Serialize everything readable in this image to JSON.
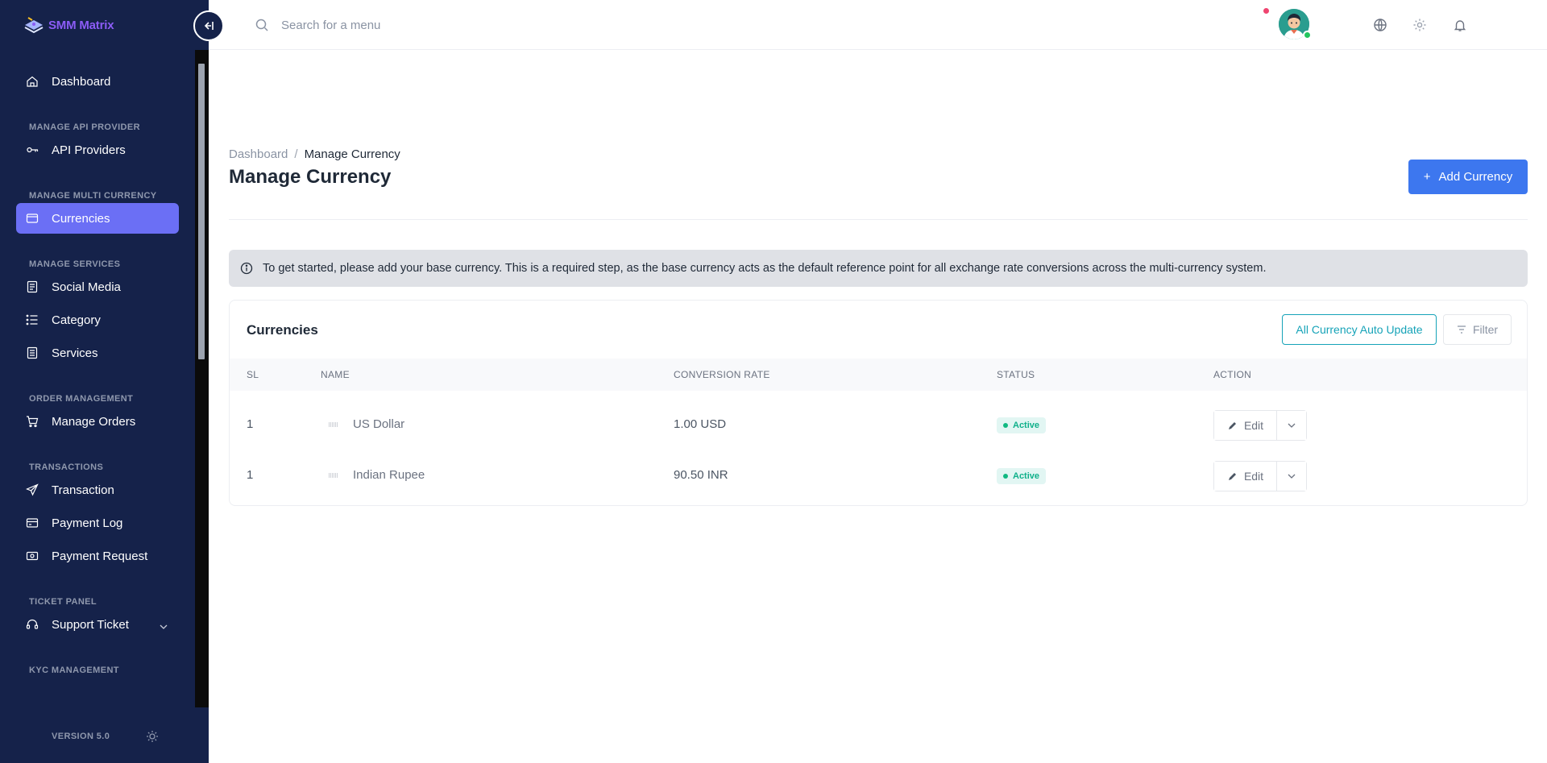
{
  "app": {
    "logo_text": "SMM Matrix"
  },
  "sidebar": {
    "items": [
      {
        "type": "item",
        "label": "Dashboard",
        "icon": "home-icon"
      },
      {
        "type": "section",
        "label": "MANAGE API PROVIDER"
      },
      {
        "type": "item",
        "label": "API Providers",
        "icon": "key-icon"
      },
      {
        "type": "section",
        "label": "MANAGE MULTI CURRENCY"
      },
      {
        "type": "item",
        "label": "Currencies",
        "icon": "wallet-icon",
        "active": true
      },
      {
        "type": "section",
        "label": "MANAGE SERVICES"
      },
      {
        "type": "item",
        "label": "Social Media",
        "icon": "document-icon"
      },
      {
        "type": "item",
        "label": "Category",
        "icon": "list-icon"
      },
      {
        "type": "item",
        "label": "Services",
        "icon": "stack-icon"
      },
      {
        "type": "section",
        "label": "ORDER MANAGEMENT"
      },
      {
        "type": "item",
        "label": "Manage Orders",
        "icon": "cart-icon"
      },
      {
        "type": "section",
        "label": "TRANSACTIONS"
      },
      {
        "type": "item",
        "label": "Transaction",
        "icon": "send-icon"
      },
      {
        "type": "item",
        "label": "Payment Log",
        "icon": "card-icon"
      },
      {
        "type": "item",
        "label": "Payment Request",
        "icon": "cash-icon"
      },
      {
        "type": "section",
        "label": "TICKET PANEL"
      },
      {
        "type": "item",
        "label": "Support Ticket",
        "icon": "headset-icon",
        "expandable": true
      },
      {
        "type": "section",
        "label": "KYC MANAGEMENT"
      }
    ],
    "version": "VERSION 5.0"
  },
  "header": {
    "search_placeholder": "Search for a menu",
    "icons": [
      "globe-icon",
      "gear-icon",
      "bell-icon"
    ]
  },
  "breadcrumb": {
    "home": "Dashboard",
    "separator": "/",
    "current": "Manage Currency"
  },
  "page_title": "Manage Currency",
  "add_button": {
    "label": "Add Currency"
  },
  "alert": {
    "text": "To get started, please add your base currency. This is a required step, as the base currency acts as the default reference point for all exchange rate conversions across the multi-currency system."
  },
  "card": {
    "title": "Currencies",
    "auto_update_label": "All Currency Auto Update",
    "filter_label": "Filter",
    "columns": [
      "SL",
      "NAME",
      "CONVERSION RATE",
      "STATUS",
      "ACTION"
    ],
    "rows": [
      {
        "sl": "1",
        "name": "US Dollar",
        "rate": "1.00 USD",
        "status": "Active",
        "action": "Edit"
      },
      {
        "sl": "1",
        "name": "Indian Rupee",
        "rate": "90.50 INR",
        "status": "Active",
        "action": "Edit"
      }
    ]
  },
  "colors": {
    "sidebar_bg": "#15224a",
    "active_item": "#6b6ff5",
    "primary_button": "#3d77ef",
    "outline_accent": "#16a3b8",
    "status_active": "#10b981"
  }
}
